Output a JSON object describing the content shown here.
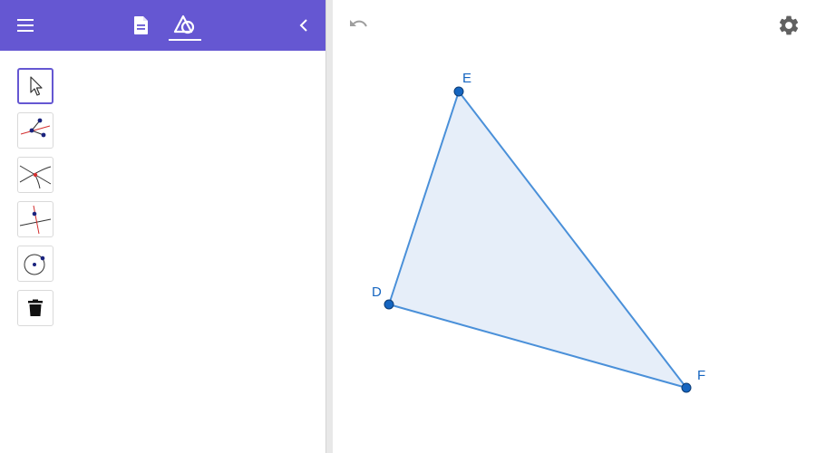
{
  "sidebar": {
    "header": {
      "menu_icon": "hamburger-menu-icon",
      "algebra_icon": "document-icon",
      "tools_icon": "geometry-tools-icon",
      "collapse_icon": "chevron-left-icon",
      "background_color": "#6557d2"
    },
    "tools": [
      {
        "name": "move-tool",
        "icon": "cursor-arrow-icon",
        "active": true
      },
      {
        "name": "angle-bisector-tool",
        "icon": "angle-bisector-icon",
        "active": false
      },
      {
        "name": "intersect-tool",
        "icon": "intersect-icon",
        "active": false
      },
      {
        "name": "perpendicular-bisector-tool",
        "icon": "perpendicular-line-icon",
        "active": false
      },
      {
        "name": "circle-tool",
        "icon": "circle-center-point-icon",
        "active": false
      },
      {
        "name": "delete-tool",
        "icon": "trash-icon",
        "active": false
      }
    ]
  },
  "graphics": {
    "undo_icon": "undo-icon",
    "settings_icon": "gear-icon",
    "polygon": {
      "fill_color": "#e6eef9",
      "stroke_color": "#4a90d9",
      "point_color": "#1565c0",
      "points": [
        {
          "label": "E"
        },
        {
          "label": "D"
        },
        {
          "label": "F"
        }
      ]
    }
  }
}
